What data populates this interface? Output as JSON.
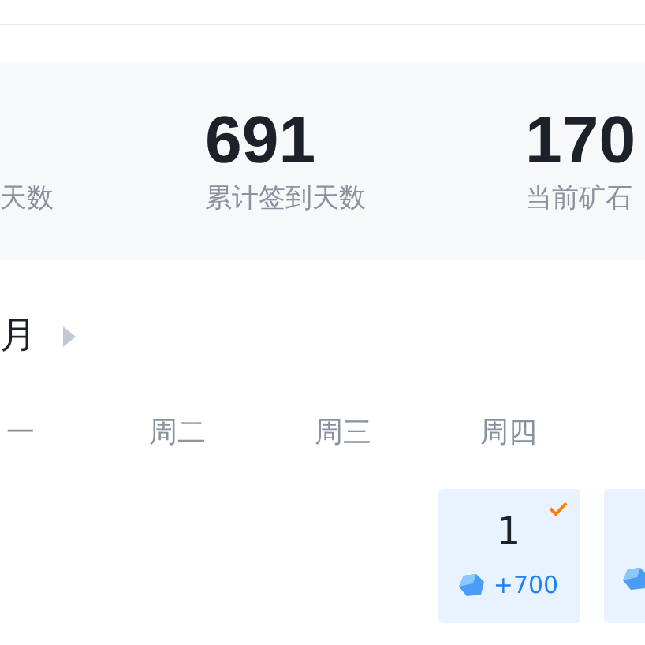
{
  "stats": [
    {
      "label": "天数"
    },
    {
      "value": "691",
      "label": "累计签到天数"
    },
    {
      "value": "170",
      "label": "当前矿石"
    }
  ],
  "month": {
    "label": "月"
  },
  "weekdays": [
    "一",
    "周二",
    "周三",
    "周四"
  ],
  "days": [
    {
      "kind": "full",
      "day": "1",
      "reward": "+700",
      "checked": true
    },
    {
      "kind": "clipped"
    }
  ]
}
